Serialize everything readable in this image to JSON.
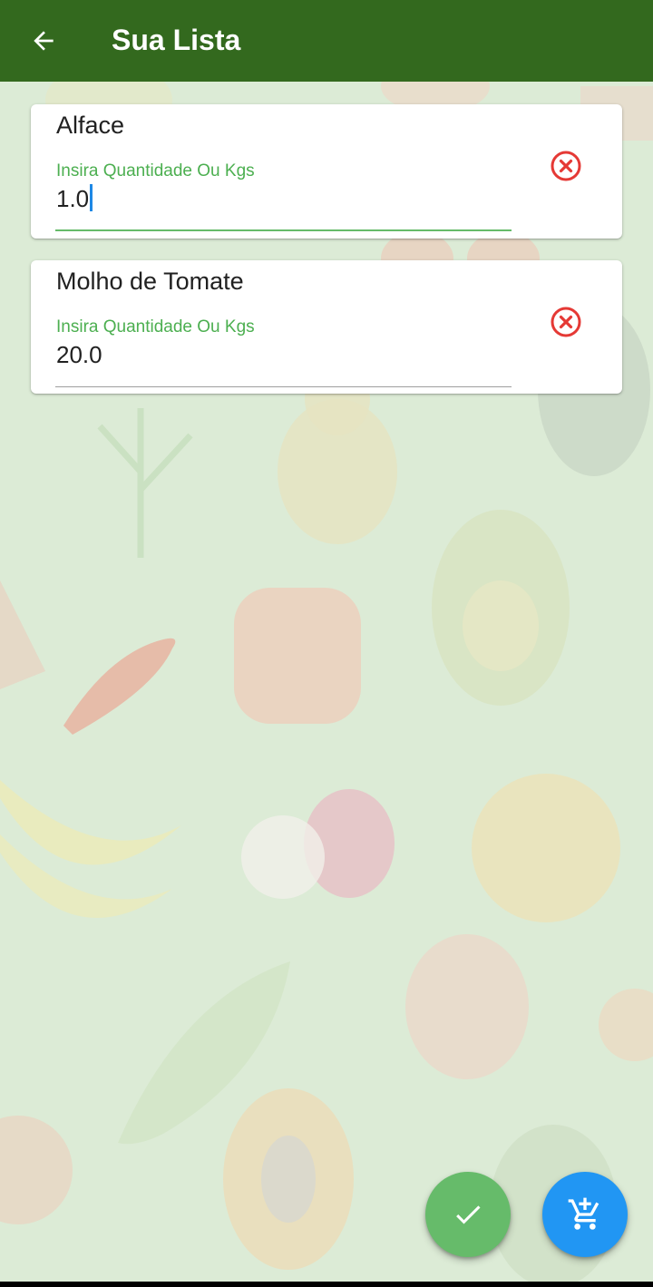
{
  "app_bar": {
    "title": "Sua Lista",
    "back_icon": "arrow-back-icon",
    "color": "#33691e"
  },
  "items": [
    {
      "name": "Alface",
      "quantity_label": "Insira Quantidade Ou Kgs",
      "quantity_value": "1.0",
      "focused": true,
      "remove_icon": "cancel-circle-icon"
    },
    {
      "name": "Molho de Tomate",
      "quantity_label": "Insira Quantidade Ou Kgs",
      "quantity_value": "20.0",
      "focused": false,
      "remove_icon": "cancel-circle-icon"
    }
  ],
  "fabs": {
    "confirm_icon": "check-icon",
    "confirm_color": "#66bb6a",
    "add_cart_icon": "add-shopping-cart-icon",
    "add_cart_color": "#2196f3"
  },
  "colors": {
    "background": "#dcebd6",
    "accent": "#4caf50",
    "remove": "#e53935"
  }
}
